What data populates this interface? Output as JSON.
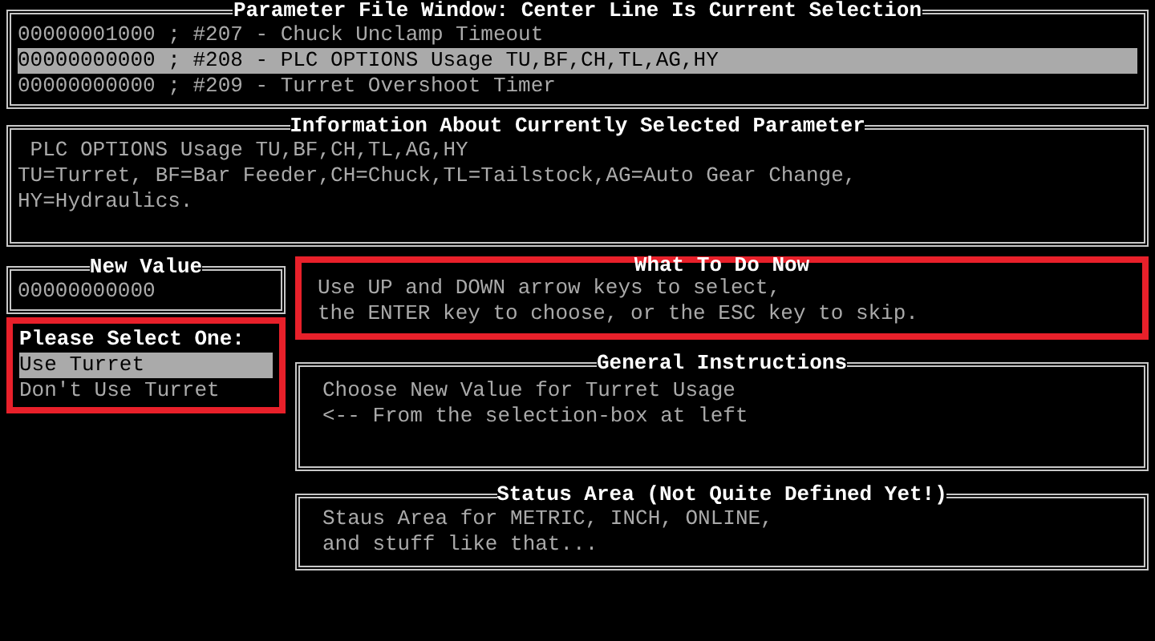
{
  "parameter_window": {
    "title": "Parameter File Window: Center Line Is Current Selection",
    "rows": [
      {
        "text": "00000001000 ; #207 - Chuck Unclamp Timeout",
        "selected": false
      },
      {
        "text": "00000000000 ; #208 - PLC OPTIONS Usage TU,BF,CH,TL,AG,HY",
        "selected": true
      },
      {
        "text": "00000000000 ; #209 - Turret Overshoot Timer",
        "selected": false
      }
    ]
  },
  "info": {
    "title": "Information About Currently Selected Parameter",
    "lines": [
      "PLC OPTIONS Usage TU,BF,CH,TL,AG,HY",
      "TU=Turret, BF=Bar Feeder,CH=Chuck,TL=Tailstock,AG=Auto Gear Change,",
      "HY=Hydraulics."
    ]
  },
  "new_value": {
    "title": "New Value",
    "value": "00000000000"
  },
  "select_box": {
    "title": "Please Select One:",
    "highlighted": true,
    "options": [
      {
        "label": "Use Turret",
        "selected": true
      },
      {
        "label": "Don't Use Turret",
        "selected": false
      }
    ]
  },
  "what_to_do": {
    "title": "What To Do Now",
    "highlighted": true,
    "lines": [
      "Use UP and DOWN arrow keys to select,",
      "the ENTER key to choose, or the ESC key to skip."
    ]
  },
  "general_instructions": {
    "title": "General Instructions",
    "lines": [
      "Choose New Value for Turret Usage",
      "<-- From the selection-box at left"
    ]
  },
  "status_area": {
    "title": "Status Area (Not Quite Defined Yet!)",
    "lines": [
      "Staus Area for METRIC, INCH, ONLINE,",
      "and stuff like that..."
    ]
  }
}
